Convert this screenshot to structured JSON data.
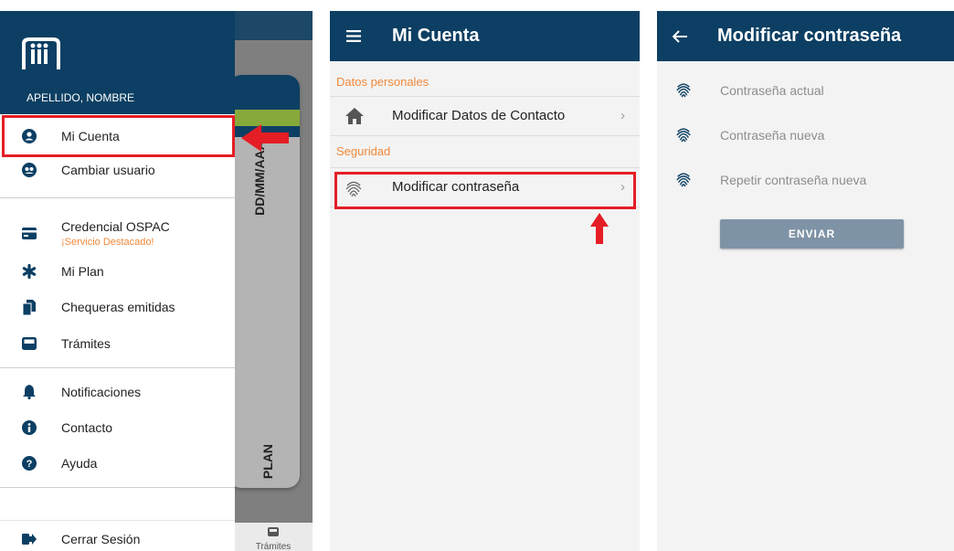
{
  "panel1": {
    "user_name": "APELLIDO, NOMBRE",
    "card_date": "DD/MM/AAAA",
    "card_plan": "PLAN",
    "bottom_nav_label": "Trámites",
    "menu": {
      "mi_cuenta": "Mi Cuenta",
      "cambiar_usuario": "Cambiar usuario",
      "credencial": "Credencial OSPAC",
      "credencial_sub": "¡Servicio Destacado!",
      "mi_plan": "Mi Plan",
      "chequeras": "Chequeras emitidas",
      "tramites": "Trámites",
      "notificaciones": "Notificaciones",
      "contacto": "Contacto",
      "ayuda": "Ayuda",
      "cerrar_sesion": "Cerrar Sesión"
    }
  },
  "panel2": {
    "title": "Mi Cuenta",
    "section_personal": "Datos personales",
    "modificar_datos": "Modificar Datos de Contacto",
    "section_seguridad": "Seguridad",
    "modificar_contrasena": "Modificar contraseña"
  },
  "panel3": {
    "title": "Modificar contraseña",
    "field_actual": "Contraseña actual",
    "field_nueva": "Contraseña nueva",
    "field_repetir": "Repetir contraseña nueva",
    "send_label": "ENVIAR"
  },
  "colors": {
    "brand_navy": "#0c3f63",
    "accent_orange": "#f0883a",
    "highlight_red": "#e51e25",
    "button_disabled": "#7f93a6",
    "card_green": "#86a93a"
  }
}
